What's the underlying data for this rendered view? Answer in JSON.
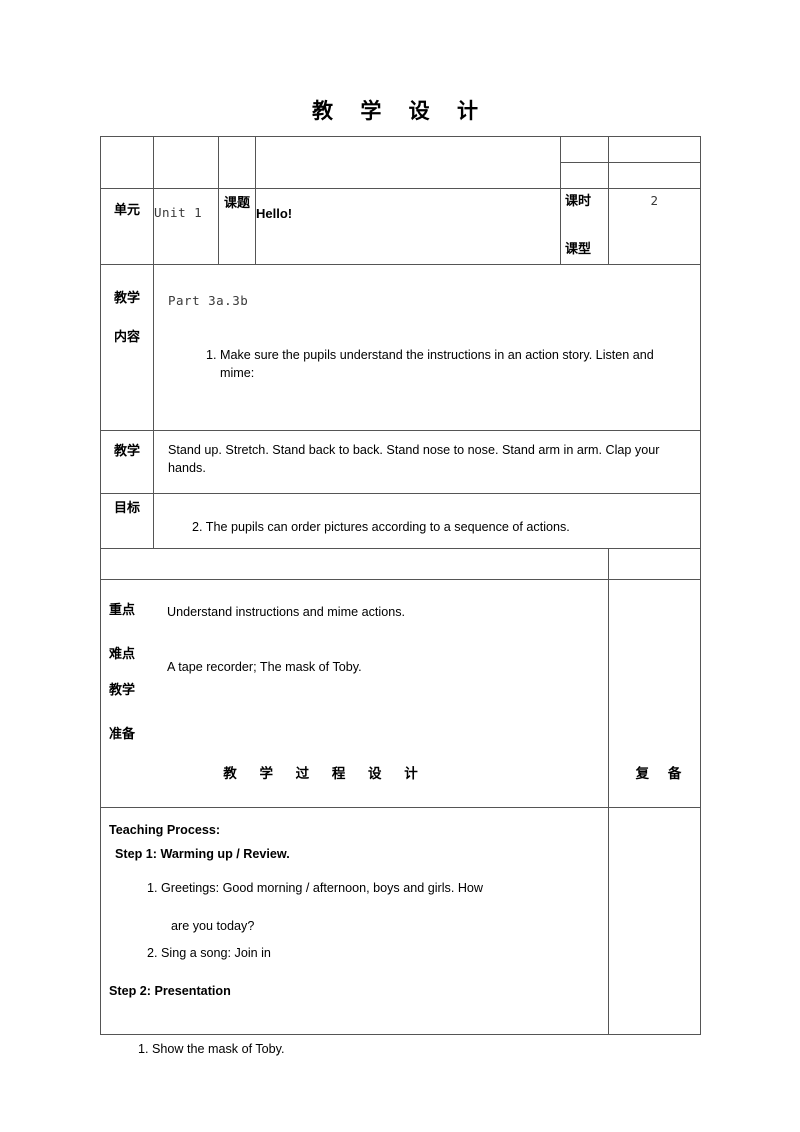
{
  "document": {
    "title": "教  学  设  计"
  },
  "header_row": {
    "unit_label": "单元",
    "unit_value": "Unit 1",
    "topic_label": "课题",
    "topic_value": "Hello!",
    "periods_label": "课时",
    "periods_value": "2",
    "class_type_label": "课型",
    "class_type_value": ""
  },
  "content_row": {
    "label_line1": "教学",
    "label_line2": "内容",
    "value": "Part 3a.3b",
    "objective_1": "1. Make sure the pupils understand the instructions in an action story. Listen and mime:"
  },
  "objectives_row": {
    "label_line1": "教学",
    "label_line2": "目标",
    "detail": "Stand up. Stretch. Stand back to back. Stand nose to nose. Stand arm in arm. Clap your hands.",
    "objective_2": "2. The pupils can order pictures according to a sequence of actions."
  },
  "key_points_row": {
    "key_label": "重点",
    "key_value": "Understand instructions and mime actions.",
    "difficult_label": "难点",
    "prep_label_line1": "教学",
    "prep_label_line2": "准备",
    "prep_value": "A tape recorder; The mask of Toby."
  },
  "process_header": {
    "left": "教  学  过  程  设  计",
    "right": "复  备"
  },
  "process_body": {
    "heading": "Teaching Process:",
    "step1": "Step 1: Warming up / Review.",
    "step1_items": [
      "1.   Greetings: Good morning / afternoon, boys and girls. How",
      "are you today?",
      "2.   Sing a song: Join in"
    ],
    "step2": "Step 2: Presentation"
  },
  "after_table": {
    "item1": "1.   Show the mask of Toby."
  }
}
